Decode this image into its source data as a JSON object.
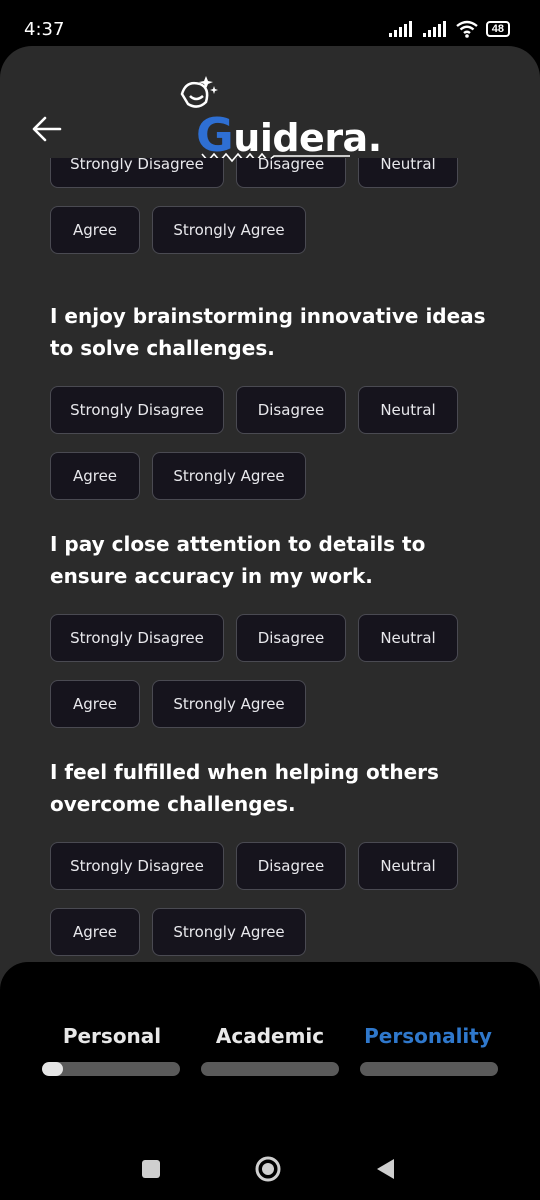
{
  "status_bar": {
    "time": "4:37",
    "battery": "48"
  },
  "header": {
    "logo_text": "uidera.",
    "logo_initial": "G"
  },
  "answer_options": [
    "Strongly Disagree",
    "Disagree",
    "Neutral",
    "Agree",
    "Strongly Agree"
  ],
  "questions": [
    {
      "text": ""
    },
    {
      "text": "I enjoy brainstorming innovative ideas to solve challenges."
    },
    {
      "text": "I pay close attention to details to ensure accuracy in my work."
    },
    {
      "text": "I feel fulfilled when helping others overcome challenges."
    }
  ],
  "tabs": [
    {
      "label": "Personal",
      "progress": 0.15,
      "active": false
    },
    {
      "label": "Academic",
      "progress": 0,
      "active": false
    },
    {
      "label": "Personality",
      "progress": 0,
      "active": true
    }
  ],
  "colors": {
    "accent": "#2f78cc",
    "background": "#2b2b2b",
    "chip": "#16141d"
  },
  "icons": [
    "back-arrow-icon",
    "square-nav-icon",
    "home-circle-icon",
    "back-triangle-icon",
    "wifi-icon",
    "signal-icon"
  ]
}
